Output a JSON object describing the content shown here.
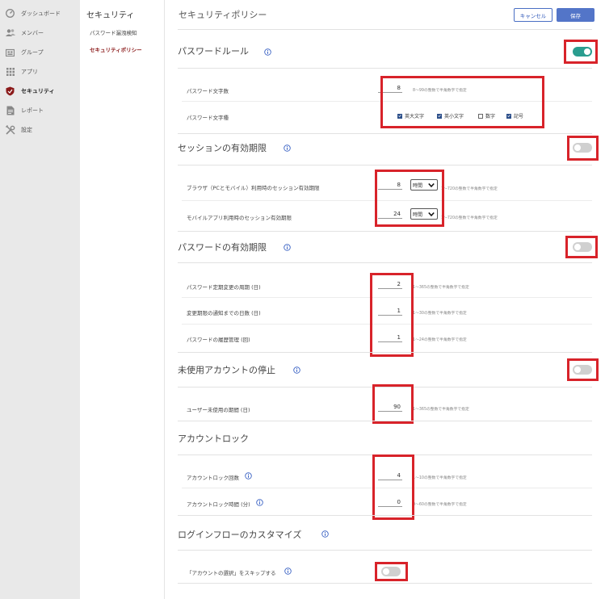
{
  "nav": {
    "items": [
      {
        "label": "ダッシュボード",
        "icon": "dashboard-icon"
      },
      {
        "label": "メンバー",
        "icon": "members-icon"
      },
      {
        "label": "グループ",
        "icon": "group-icon"
      },
      {
        "label": "アプリ",
        "icon": "apps-icon"
      },
      {
        "label": "セキュリティ",
        "icon": "shield-icon"
      },
      {
        "label": "レポート",
        "icon": "report-icon"
      },
      {
        "label": "設定",
        "icon": "settings-icon"
      }
    ],
    "active_index": 4
  },
  "subnav": {
    "title": "セキュリティ",
    "items": [
      {
        "label": "パスワード漏洩検知"
      },
      {
        "label": "セキュリティポリシー"
      }
    ],
    "active_index": 1
  },
  "header": {
    "title": "セキュリティポリシー",
    "cancel_label": "キャンセル",
    "save_label": "保存"
  },
  "sections": {
    "password_rule": {
      "title": "パスワードルール",
      "enabled": true,
      "length_label": "パスワード文字数",
      "length_value": "8",
      "length_hint": "8～99の整数で半角数字で指定",
      "types_label": "パスワード文字種",
      "types": [
        {
          "label": "英大文字",
          "checked": true
        },
        {
          "label": "英小文字",
          "checked": true
        },
        {
          "label": "数字",
          "checked": false
        },
        {
          "label": "記号",
          "checked": true
        }
      ]
    },
    "session": {
      "title": "セッションの有効期限",
      "enabled": false,
      "browser_label": "ブラウザ（PCとモバイル）利用時のセッション有効期限",
      "browser_value": "8",
      "browser_unit": "時間",
      "browser_hint": "1～720の整数で半角数字で指定",
      "mobile_label": "モバイルアプリ利用時のセッション有効期限",
      "mobile_value": "24",
      "mobile_unit": "時間",
      "mobile_hint": "1～720の整数で半角数字で指定"
    },
    "password_expiry": {
      "title": "パスワードの有効期限",
      "enabled": false,
      "interval_label": "パスワード定期変更の周期 (日)",
      "interval_value": "2",
      "interval_hint": "1～365の整数で半角数字で指定",
      "notice_label": "変更期限の通知までの日数 (日)",
      "notice_value": "1",
      "notice_hint": "1～30の整数で半角数字で指定",
      "history_label": "パスワードの履歴管理 (回)",
      "history_value": "1",
      "history_hint": "1～24の整数で半角数字で指定"
    },
    "unused_account": {
      "title": "未使用アカウントの停止",
      "enabled": false,
      "period_label": "ユーザー未使用の期間 (日)",
      "period_value": "90",
      "period_hint": "1～365の整数で半角数字で指定"
    },
    "account_lock": {
      "title": "アカウントロック",
      "count_label": "アカウントロック回数",
      "count_value": "4",
      "count_hint": "1～10の整数で半角数字で指定",
      "time_label": "アカウントロック時間 (分)",
      "time_value": "0",
      "time_hint": "0～60の整数で半角数字で指定"
    },
    "login_flow": {
      "title": "ログインフローのカスタマイズ",
      "skip_label": "「アカウントの選択」をスキップする",
      "skip_enabled": false
    }
  },
  "colors": {
    "accent": "#5375c8",
    "toggle_on": "#2a9d8f",
    "highlight": "#d8232a",
    "active_nav": "#8b1a1a"
  }
}
